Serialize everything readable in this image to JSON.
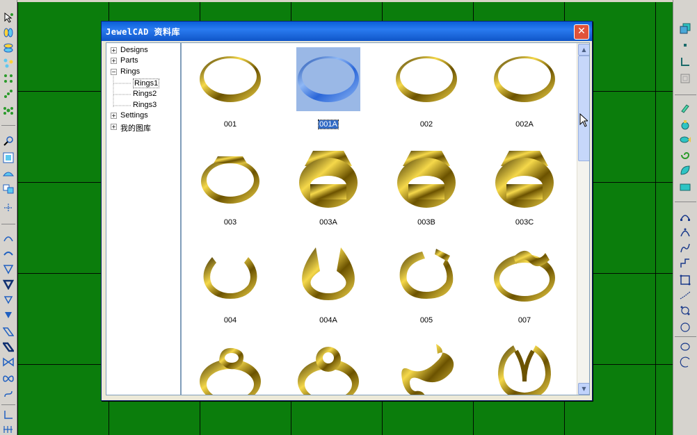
{
  "window": {
    "title": "JewelCAD 资料库",
    "close_label": "✕"
  },
  "tree": {
    "items": [
      {
        "label": "Designs",
        "expander": "+"
      },
      {
        "label": "Parts",
        "expander": "+"
      },
      {
        "label": "Rings",
        "expander": "−"
      },
      {
        "label": "Rings1"
      },
      {
        "label": "Rings2"
      },
      {
        "label": "Rings3"
      },
      {
        "label": "Settings",
        "expander": "+"
      },
      {
        "label": "我的图库",
        "expander": "+"
      }
    ],
    "selected": "Rings1"
  },
  "gallery": {
    "items": [
      {
        "label": "001",
        "shape": "band"
      },
      {
        "label": "001A",
        "shape": "band-selected",
        "selected": true
      },
      {
        "label": "002",
        "shape": "band"
      },
      {
        "label": "002A",
        "shape": "band"
      },
      {
        "label": "003",
        "shape": "signet-thin"
      },
      {
        "label": "003A",
        "shape": "signet"
      },
      {
        "label": "003B",
        "shape": "signet"
      },
      {
        "label": "003C",
        "shape": "signet"
      },
      {
        "label": "004",
        "shape": "open"
      },
      {
        "label": "004A",
        "shape": "open-pointed"
      },
      {
        "label": "005",
        "shape": "open-c"
      },
      {
        "label": "007",
        "shape": "wave"
      },
      {
        "label": "",
        "shape": "heart"
      },
      {
        "label": "",
        "shape": "knot"
      },
      {
        "label": "",
        "shape": "swirl"
      },
      {
        "label": "",
        "shape": "heart-open"
      }
    ]
  },
  "colors": {
    "canvas": "#0b7d0c",
    "gold": "#c9a800",
    "selected": "#316ac5",
    "titlebar": "#0a5fd8"
  }
}
